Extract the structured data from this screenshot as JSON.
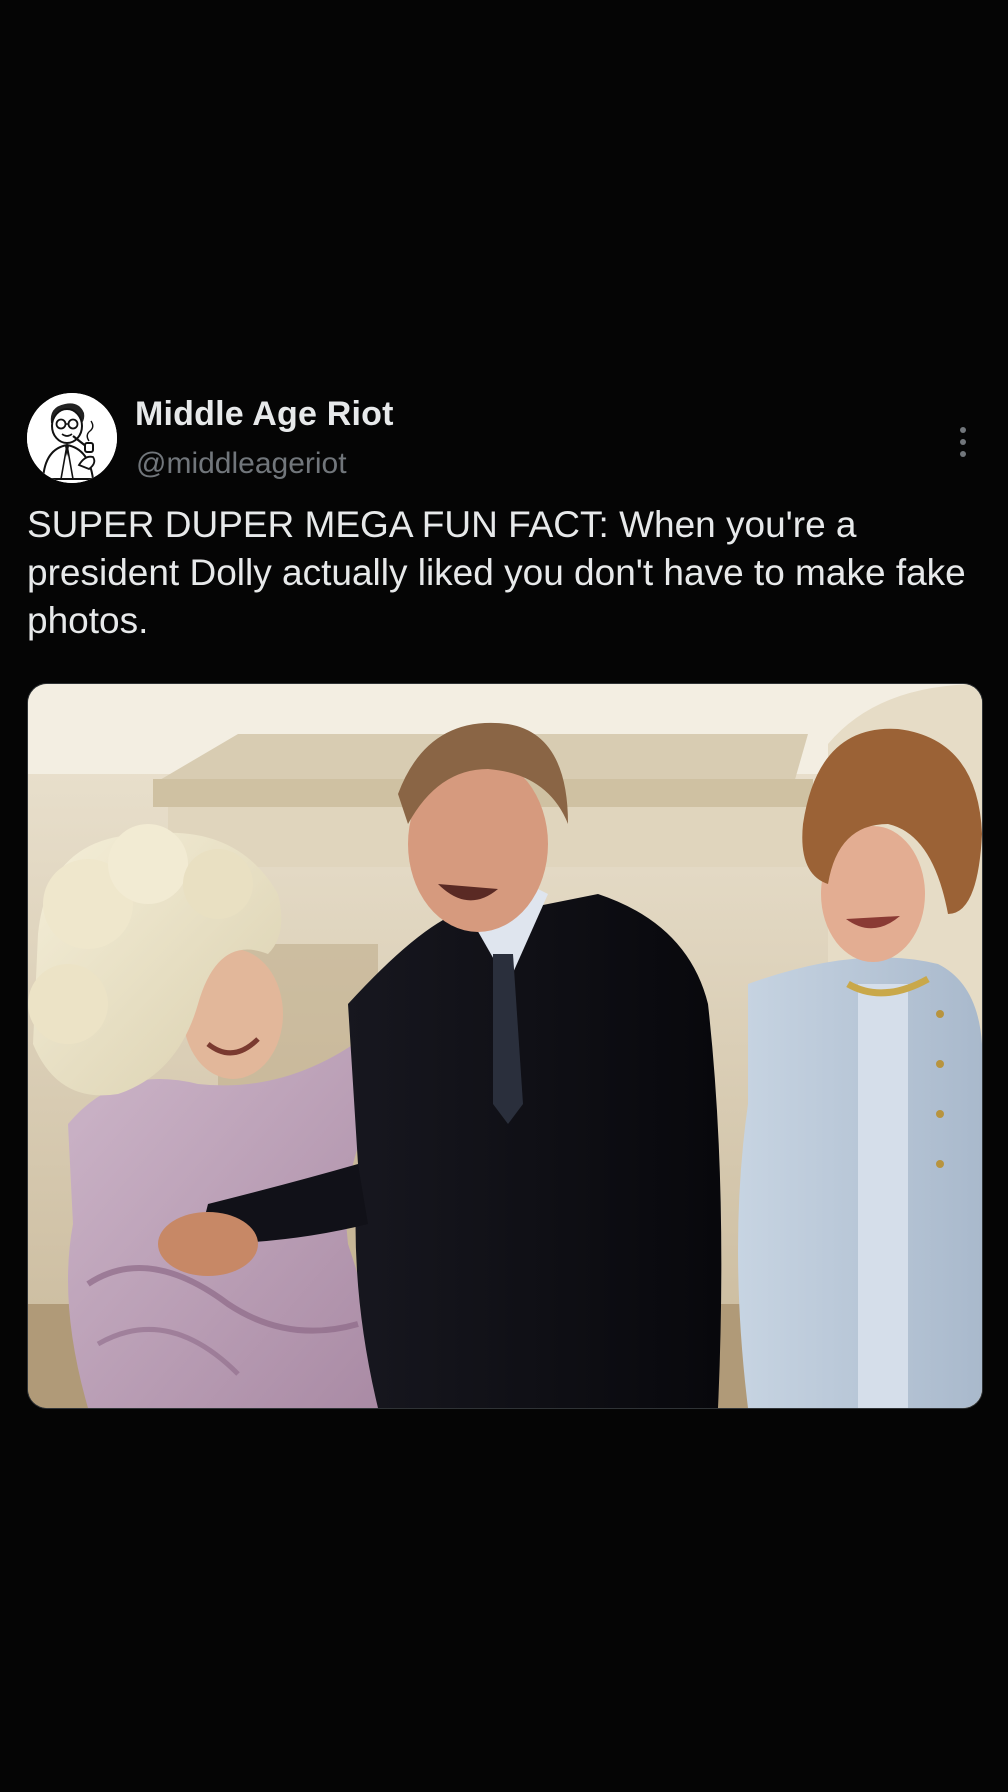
{
  "tweet": {
    "author": {
      "display_name": "Middle Age Riot",
      "handle": "@middleageriot",
      "avatar_icon": "cartoon-man-with-pipe-avatar"
    },
    "more_icon": "vertical-ellipsis-icon",
    "text": "SUPER DUPER MEGA FUN FACT: When you're a president Dolly actually liked you don't have to make fake photos.",
    "media": {
      "type": "photo"
    }
  },
  "colors": {
    "background": "#050505",
    "text_primary": "#e7e9ea",
    "text_secondary": "#71767b"
  }
}
